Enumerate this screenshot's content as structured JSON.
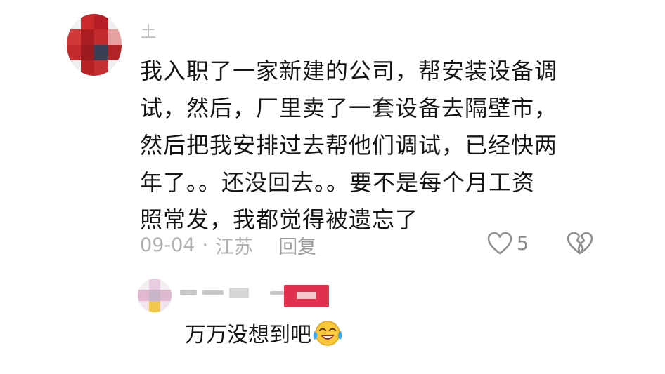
{
  "comment": {
    "username": "土",
    "lines": [
      "我入职了一家新建的公司，帮安装设备调",
      "试，然后，厂里卖了一套设备去隔壁市，",
      "然后把我安排过去帮他们调试，已经快两",
      "年了。。还没回去。。要不是每个月工资",
      "照常发，我都觉得被遗忘了"
    ],
    "date": "09-04",
    "separator": "·",
    "location": "江苏",
    "reply_label": "回复",
    "like_count": "5",
    "icons": [
      "heart-outline-icon",
      "broken-heart-icon"
    ]
  },
  "reply": {
    "text": "万万没想到吧",
    "emoji": "laughing-crying-emoji-icon",
    "badge_color": "#e0304e"
  }
}
